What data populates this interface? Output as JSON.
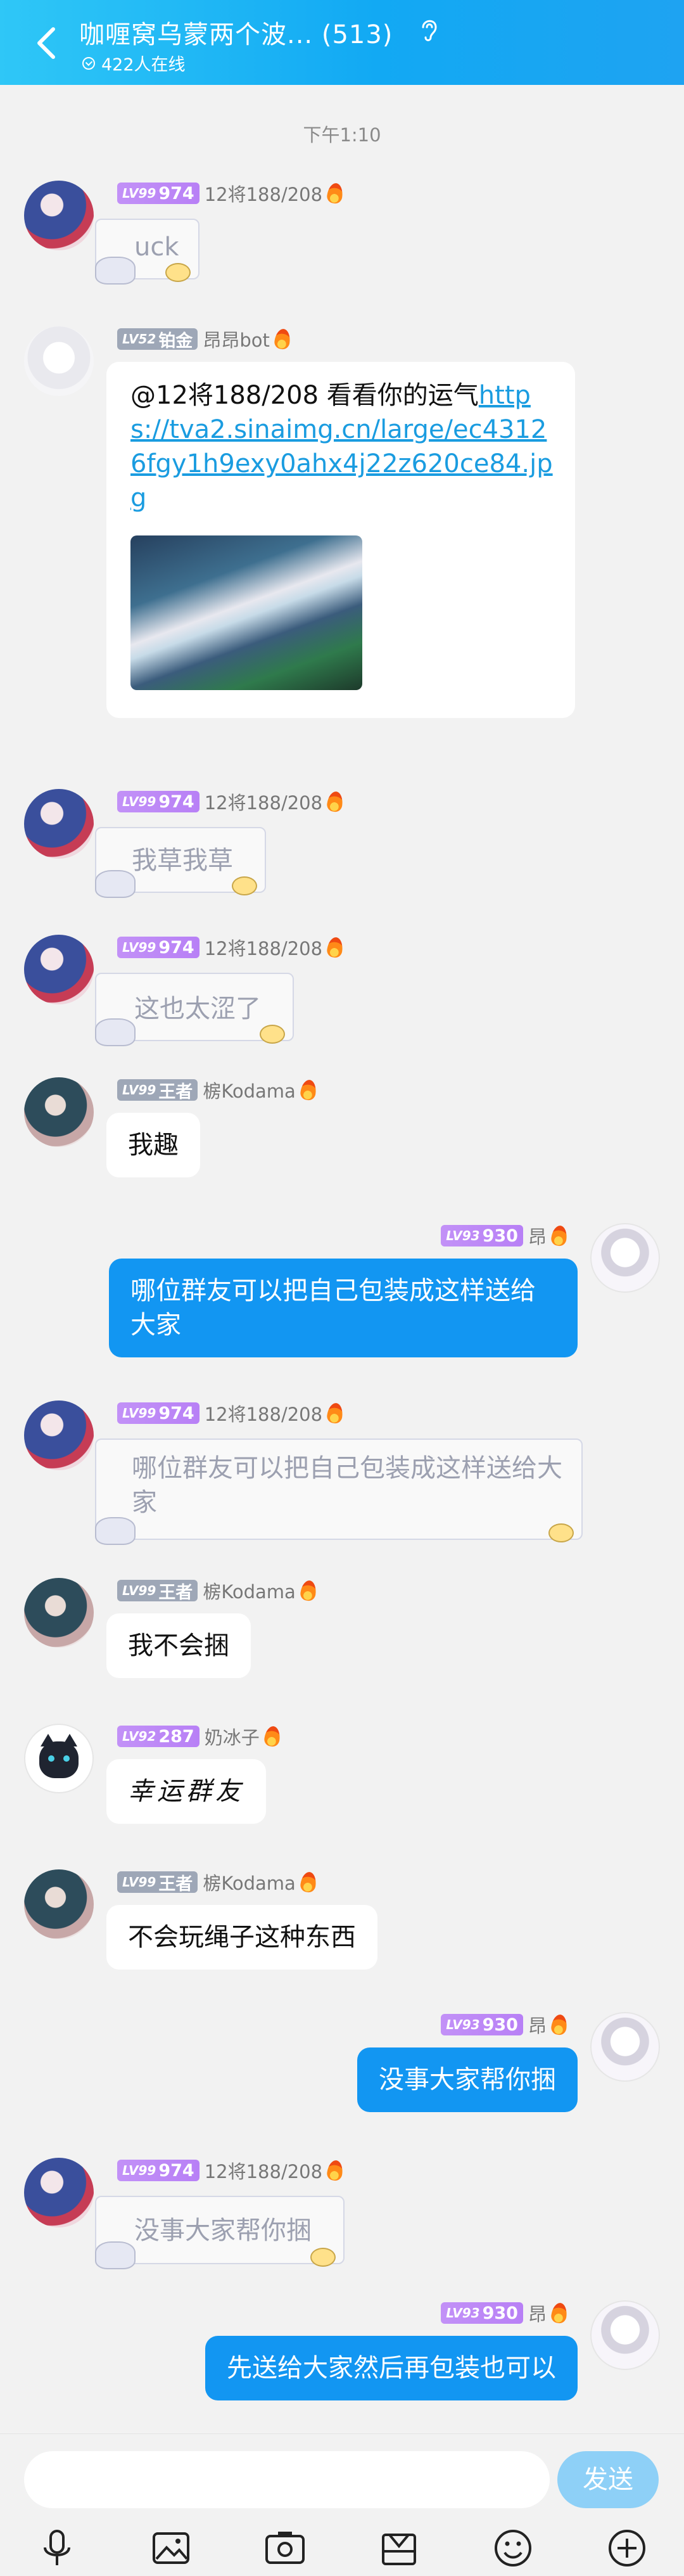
{
  "header": {
    "title": "咖喱窝乌蒙两个波... (513)",
    "online": "422人在线",
    "back_icon": "back-chevron-icon",
    "mode_icon": "ear-icon"
  },
  "timestamp": "下午1:10",
  "messages": [
    {
      "lv": "LV99",
      "rank": "974",
      "name": "12将188/208",
      "sticker_text": "uck"
    },
    {
      "lv": "LV52",
      "rank": "铂金",
      "name": "昂昂bot",
      "text_prefix": "@12将188/208  看看你的运气",
      "link": "https://tva2.sinaimg.cn/large/ec43126fgy1h9exy0ahx4j22z620ce84.jpg"
    },
    {
      "lv": "LV99",
      "rank": "974",
      "name": "12将188/208",
      "sticker_text": "我草我草"
    },
    {
      "lv": "LV99",
      "rank": "974",
      "name": "12将188/208",
      "sticker_text": "这也太涩了"
    },
    {
      "lv": "LV99",
      "rank": "王者",
      "name": "椖Kodama",
      "text": "我趣"
    },
    {
      "lv": "LV93",
      "rank": "930",
      "name": "昂",
      "text": "哪位群友可以把自己包装成这样送给大家"
    },
    {
      "lv": "LV99",
      "rank": "974",
      "name": "12将188/208",
      "sticker_text": "哪位群友可以把自己包装成这样送给大家"
    },
    {
      "lv": "LV99",
      "rank": "王者",
      "name": "椖Kodama",
      "text": "我不会捆"
    },
    {
      "lv": "LV92",
      "rank": "287",
      "name": "奶冰子",
      "text": "幸运群友"
    },
    {
      "lv": "LV99",
      "rank": "王者",
      "name": "椖Kodama",
      "text": "不会玩绳子这种东西"
    },
    {
      "lv": "LV93",
      "rank": "930",
      "name": "昂",
      "text": "没事大家帮你捆"
    },
    {
      "lv": "LV99",
      "rank": "974",
      "name": "12将188/208",
      "sticker_text": "没事大家帮你捆"
    },
    {
      "lv": "LV93",
      "rank": "930",
      "name": "昂",
      "text": "先送给大家然后再包装也可以"
    }
  ],
  "input": {
    "placeholder": "",
    "send_label": "发送"
  },
  "toolbar": [
    "microphone-icon",
    "image-icon",
    "camera-icon",
    "gift-icon",
    "emoji-icon",
    "plus-icon"
  ]
}
